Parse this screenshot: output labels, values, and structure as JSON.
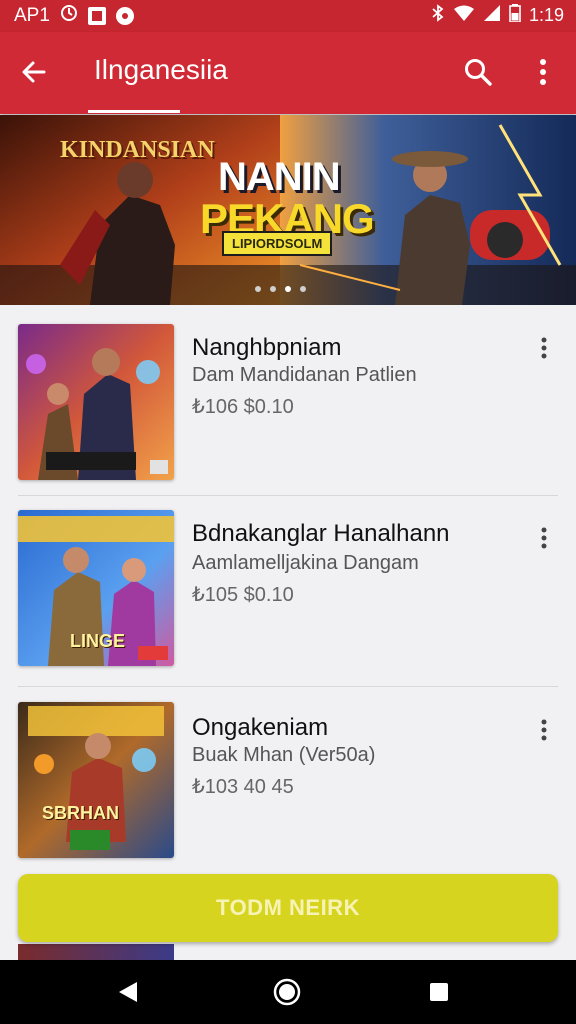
{
  "status_bar": {
    "left_text": "AP1",
    "time": "1:19",
    "icons": [
      "sync-icon",
      "notification-square-icon",
      "notification-circle-icon",
      "bluetooth-icon",
      "wifi-icon",
      "signal-icon",
      "battery-icon"
    ]
  },
  "app_bar": {
    "title": "Ilnganesiia",
    "icons": [
      "back-arrow-icon",
      "search-icon",
      "more-vert-icon"
    ]
  },
  "banner": {
    "subtitle": "KINDANSIAN",
    "title_line1": "NANIN",
    "title_line2": "PEKANG",
    "tag": "LIPIORDSOLM",
    "page_count": 4,
    "active_page": 0
  },
  "items": [
    {
      "title": "Nanghbpniam",
      "subtitle": "Dam Mandidanan Patlien",
      "price": "₺106  $0.10",
      "thumb_caption": ""
    },
    {
      "title": "Bdnakanglar Hanalhann",
      "subtitle": "Aamlamelljakina Dangam",
      "price": "₺105  $0.10",
      "thumb_caption": "LINGE"
    },
    {
      "title": "Ongakeniam",
      "subtitle": "Buak Mhan (Ver50a)",
      "price": "₺103  40 45",
      "thumb_caption": "SBRHAN"
    }
  ],
  "cta": {
    "label": "TODM NEIRK"
  },
  "colors": {
    "status_bar": "#c62630",
    "app_bar": "#cf2a35",
    "cta": "#d6d41f",
    "background": "#f1f1f3"
  }
}
